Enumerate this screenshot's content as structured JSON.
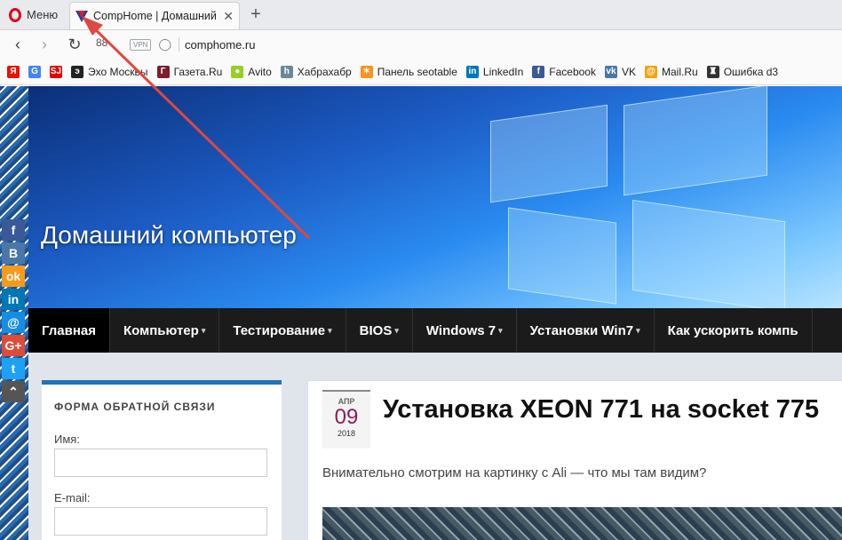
{
  "browser": {
    "menu_label": "Меню",
    "tab_title": "CompHome | Домашний к",
    "url": "comphome.ru",
    "vpn_badge": "VPN",
    "speed_dial": "88"
  },
  "bookmarks": [
    {
      "icon": "yandex-icon",
      "label": "",
      "color": "#e61400",
      "glyph": "Я"
    },
    {
      "icon": "google-icon",
      "label": "",
      "color": "#4285f4",
      "glyph": "G"
    },
    {
      "icon": "sj-icon",
      "label": "",
      "color": "#e60000",
      "glyph": "SJ"
    },
    {
      "icon": "echo-icon",
      "label": "Эхо Москвы",
      "color": "#222222",
      "glyph": "э"
    },
    {
      "icon": "gazeta-icon",
      "label": "Газета.Ru",
      "color": "#7a1f2b",
      "glyph": "Г"
    },
    {
      "icon": "avito-icon",
      "label": "Avito",
      "color": "#97cf26",
      "glyph": "●"
    },
    {
      "icon": "habr-icon",
      "label": "Хабрахабр",
      "color": "#6b8799",
      "glyph": "h"
    },
    {
      "icon": "seotable-icon",
      "label": "Панель seotable",
      "color": "#f7931e",
      "glyph": "✶"
    },
    {
      "icon": "linkedin-icon",
      "label": "LinkedIn",
      "color": "#0077b5",
      "glyph": "in"
    },
    {
      "icon": "facebook-icon",
      "label": "Facebook",
      "color": "#3b5998",
      "glyph": "f"
    },
    {
      "icon": "vk-icon",
      "label": "VK",
      "color": "#4a76a8",
      "glyph": "vk"
    },
    {
      "icon": "mailru-icon",
      "label": "Mail.Ru",
      "color": "#f2a30f",
      "glyph": "@"
    },
    {
      "icon": "tanks-icon",
      "label": "Ошибка d3",
      "color": "#333333",
      "glyph": "♜"
    }
  ],
  "social": [
    {
      "icon": "facebook-share-icon",
      "glyph": "f",
      "color": "#3b5998"
    },
    {
      "icon": "vk-share-icon",
      "glyph": "B",
      "color": "#4a76a8"
    },
    {
      "icon": "odnoklassniki-share-icon",
      "glyph": "ok",
      "color": "#f59a1b"
    },
    {
      "icon": "linkedin-share-icon",
      "glyph": "in",
      "color": "#0077b5"
    },
    {
      "icon": "mailru-share-icon",
      "glyph": "@",
      "color": "#168de2"
    },
    {
      "icon": "googleplus-share-icon",
      "glyph": "G+",
      "color": "#dd4b39"
    },
    {
      "icon": "twitter-share-icon",
      "glyph": "t",
      "color": "#1da1f2"
    },
    {
      "icon": "scroll-top-icon",
      "glyph": "⌃",
      "color": "#555555"
    }
  ],
  "site": {
    "title": "Домашний компьютер"
  },
  "nav": [
    {
      "label": "Главная",
      "caret": false,
      "active": true
    },
    {
      "label": "Компьютер",
      "caret": true
    },
    {
      "label": "Тестирование",
      "caret": true
    },
    {
      "label": "BIOS",
      "caret": true
    },
    {
      "label": "Windows 7",
      "caret": true
    },
    {
      "label": "Установки Win7",
      "caret": true
    },
    {
      "label": "Как ускорить компь",
      "caret": false
    }
  ],
  "sidebar": {
    "widget_title": "ФОРМА ОБРАТНОЙ СВЯЗИ",
    "name_label": "Имя:",
    "email_label": "E-mail:"
  },
  "post": {
    "month": "АПР",
    "day": "09",
    "year": "2018",
    "title": "Установка XEON 771 на socket 775",
    "text": "Внимательно смотрим на картинку с Ali — что мы там видим?"
  },
  "colors": {
    "accent": "#1e73be",
    "nav_bg": "#1b1b1b",
    "arrow": "#e0473f"
  }
}
